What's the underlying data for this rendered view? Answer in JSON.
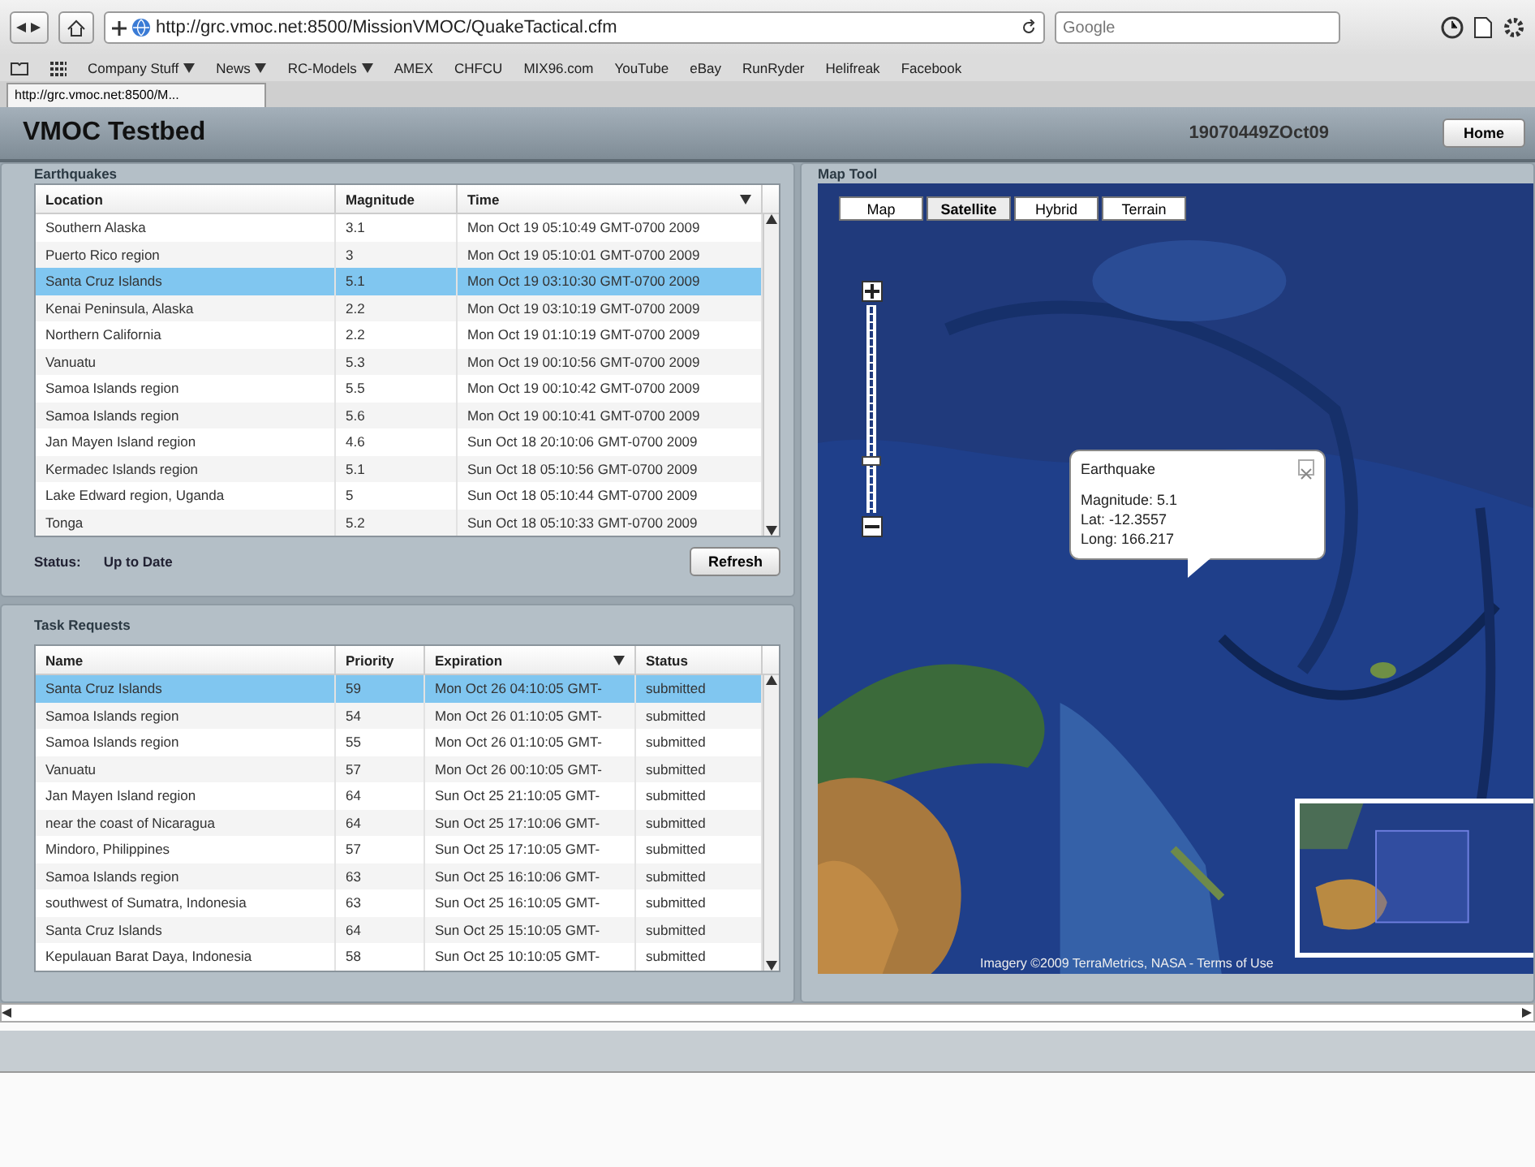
{
  "browser": {
    "url": "http://grc.vmoc.net:8500/MissionVMOC/QuakeTactical.cfm",
    "search": {
      "placeholder": "Google"
    },
    "bookmarks": [
      {
        "label": "Company Stuff",
        "has_menu": true
      },
      {
        "label": "News",
        "has_menu": true
      },
      {
        "label": "RC-Models",
        "has_menu": true
      },
      {
        "label": "AMEX",
        "has_menu": false
      },
      {
        "label": "CHFCU",
        "has_menu": false
      },
      {
        "label": "MIX96.com",
        "has_menu": false
      },
      {
        "label": "YouTube",
        "has_menu": false
      },
      {
        "label": "eBay",
        "has_menu": false
      },
      {
        "label": "RunRyder",
        "has_menu": false
      },
      {
        "label": "Helifreak",
        "has_menu": false
      },
      {
        "label": "Facebook",
        "has_menu": false
      }
    ],
    "tab_title": "http://grc.vmoc.net:8500/M..."
  },
  "app": {
    "title": "VMOC Testbed",
    "dtg": "19070449ZOct09",
    "home_button": "Home"
  },
  "earthquakes": {
    "title": "Earthquakes",
    "columns": [
      {
        "label": "Location",
        "sorted": false
      },
      {
        "label": "Magnitude",
        "sorted": false
      },
      {
        "label": "Time",
        "sorted": true
      }
    ],
    "rows": [
      {
        "location": "Southern Alaska",
        "magnitude": "3.1",
        "time": "Mon Oct 19 05:10:49 GMT-0700 2009",
        "selected": false
      },
      {
        "location": "Puerto Rico region",
        "magnitude": "3",
        "time": "Mon Oct 19 05:10:01 GMT-0700 2009",
        "selected": false
      },
      {
        "location": "Santa Cruz Islands",
        "magnitude": "5.1",
        "time": "Mon Oct 19 03:10:30 GMT-0700 2009",
        "selected": true
      },
      {
        "location": "Kenai Peninsula, Alaska",
        "magnitude": "2.2",
        "time": "Mon Oct 19 03:10:19 GMT-0700 2009",
        "selected": false
      },
      {
        "location": "Northern California",
        "magnitude": "2.2",
        "time": "Mon Oct 19 01:10:19 GMT-0700 2009",
        "selected": false
      },
      {
        "location": "Vanuatu",
        "magnitude": "5.3",
        "time": "Mon Oct 19 00:10:56 GMT-0700 2009",
        "selected": false
      },
      {
        "location": "Samoa Islands region",
        "magnitude": "5.5",
        "time": "Mon Oct 19 00:10:42 GMT-0700 2009",
        "selected": false
      },
      {
        "location": "Samoa Islands region",
        "magnitude": "5.6",
        "time": "Mon Oct 19 00:10:41 GMT-0700 2009",
        "selected": false
      },
      {
        "location": "Jan Mayen Island region",
        "magnitude": "4.6",
        "time": "Sun Oct 18 20:10:06 GMT-0700 2009",
        "selected": false
      },
      {
        "location": "Kermadec Islands region",
        "magnitude": "5.1",
        "time": "Sun Oct 18 05:10:56 GMT-0700 2009",
        "selected": false
      },
      {
        "location": "Lake Edward region, Uganda",
        "magnitude": "5",
        "time": "Sun Oct 18 05:10:44 GMT-0700 2009",
        "selected": false
      },
      {
        "location": "Tonga",
        "magnitude": "5.2",
        "time": "Sun Oct 18 05:10:33 GMT-0700 2009",
        "selected": false
      }
    ],
    "status_label": "Status:",
    "status_value": "Up to Date",
    "refresh_button": "Refresh"
  },
  "tasks": {
    "title": "Task Requests",
    "columns": [
      {
        "label": "Name",
        "sorted": false
      },
      {
        "label": "Priority",
        "sorted": false
      },
      {
        "label": "Expiration",
        "sorted": true
      },
      {
        "label": "Status",
        "sorted": false
      }
    ],
    "rows": [
      {
        "name": "Santa Cruz Islands",
        "priority": "59",
        "expiration": "Mon Oct 26 04:10:05 GMT-",
        "status": "submitted",
        "selected": true
      },
      {
        "name": "Samoa Islands region",
        "priority": "54",
        "expiration": "Mon Oct 26 01:10:05 GMT-",
        "status": "submitted",
        "selected": false
      },
      {
        "name": "Samoa Islands region",
        "priority": "55",
        "expiration": "Mon Oct 26 01:10:05 GMT-",
        "status": "submitted",
        "selected": false
      },
      {
        "name": "Vanuatu",
        "priority": "57",
        "expiration": "Mon Oct 26 00:10:05 GMT-",
        "status": "submitted",
        "selected": false
      },
      {
        "name": "Jan Mayen Island region",
        "priority": "64",
        "expiration": "Sun Oct 25 21:10:05 GMT-",
        "status": "submitted",
        "selected": false
      },
      {
        "name": "near the coast of Nicaragua",
        "priority": "64",
        "expiration": "Sun Oct 25 17:10:06 GMT-",
        "status": "submitted",
        "selected": false
      },
      {
        "name": "Mindoro, Philippines",
        "priority": "57",
        "expiration": "Sun Oct 25 17:10:05 GMT-",
        "status": "submitted",
        "selected": false
      },
      {
        "name": "Samoa Islands region",
        "priority": "63",
        "expiration": "Sun Oct 25 16:10:06 GMT-",
        "status": "submitted",
        "selected": false
      },
      {
        "name": "southwest of Sumatra, Indonesia",
        "priority": "63",
        "expiration": "Sun Oct 25 16:10:05 GMT-",
        "status": "submitted",
        "selected": false
      },
      {
        "name": "Santa Cruz Islands",
        "priority": "64",
        "expiration": "Sun Oct 25 15:10:05 GMT-",
        "status": "submitted",
        "selected": false
      },
      {
        "name": "Kepulauan Barat Daya, Indonesia",
        "priority": "58",
        "expiration": "Sun Oct 25 10:10:05 GMT-",
        "status": "submitted",
        "selected": false
      }
    ]
  },
  "map": {
    "title": "Map Tool",
    "map_types": [
      {
        "label": "Map",
        "selected": false
      },
      {
        "label": "Satellite",
        "selected": true
      },
      {
        "label": "Hybrid",
        "selected": false
      },
      {
        "label": "Terrain",
        "selected": false
      }
    ],
    "zoom": {
      "level": 0.25
    },
    "popup": {
      "title": "Earthquake",
      "lines": [
        "Magnitude: 5.1",
        "Lat: -12.3557",
        "Long: 166.217"
      ]
    },
    "attribution": "Imagery ©2009  TerraMetrics, NASA - Terms of Use"
  }
}
